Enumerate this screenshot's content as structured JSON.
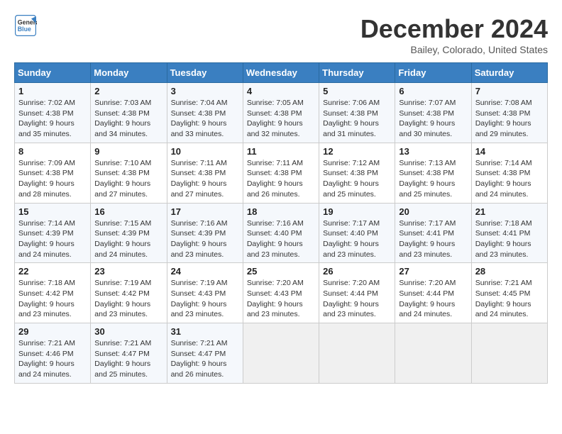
{
  "logo": {
    "line1": "General",
    "line2": "Blue"
  },
  "title": "December 2024",
  "location": "Bailey, Colorado, United States",
  "days_header": [
    "Sunday",
    "Monday",
    "Tuesday",
    "Wednesday",
    "Thursday",
    "Friday",
    "Saturday"
  ],
  "weeks": [
    [
      {
        "day": "1",
        "sunrise": "7:02 AM",
        "sunset": "4:38 PM",
        "daylight": "9 hours and 35 minutes."
      },
      {
        "day": "2",
        "sunrise": "7:03 AM",
        "sunset": "4:38 PM",
        "daylight": "9 hours and 34 minutes."
      },
      {
        "day": "3",
        "sunrise": "7:04 AM",
        "sunset": "4:38 PM",
        "daylight": "9 hours and 33 minutes."
      },
      {
        "day": "4",
        "sunrise": "7:05 AM",
        "sunset": "4:38 PM",
        "daylight": "9 hours and 32 minutes."
      },
      {
        "day": "5",
        "sunrise": "7:06 AM",
        "sunset": "4:38 PM",
        "daylight": "9 hours and 31 minutes."
      },
      {
        "day": "6",
        "sunrise": "7:07 AM",
        "sunset": "4:38 PM",
        "daylight": "9 hours and 30 minutes."
      },
      {
        "day": "7",
        "sunrise": "7:08 AM",
        "sunset": "4:38 PM",
        "daylight": "9 hours and 29 minutes."
      }
    ],
    [
      {
        "day": "8",
        "sunrise": "7:09 AM",
        "sunset": "4:38 PM",
        "daylight": "9 hours and 28 minutes."
      },
      {
        "day": "9",
        "sunrise": "7:10 AM",
        "sunset": "4:38 PM",
        "daylight": "9 hours and 27 minutes."
      },
      {
        "day": "10",
        "sunrise": "7:11 AM",
        "sunset": "4:38 PM",
        "daylight": "9 hours and 27 minutes."
      },
      {
        "day": "11",
        "sunrise": "7:11 AM",
        "sunset": "4:38 PM",
        "daylight": "9 hours and 26 minutes."
      },
      {
        "day": "12",
        "sunrise": "7:12 AM",
        "sunset": "4:38 PM",
        "daylight": "9 hours and 25 minutes."
      },
      {
        "day": "13",
        "sunrise": "7:13 AM",
        "sunset": "4:38 PM",
        "daylight": "9 hours and 25 minutes."
      },
      {
        "day": "14",
        "sunrise": "7:14 AM",
        "sunset": "4:38 PM",
        "daylight": "9 hours and 24 minutes."
      }
    ],
    [
      {
        "day": "15",
        "sunrise": "7:14 AM",
        "sunset": "4:39 PM",
        "daylight": "9 hours and 24 minutes."
      },
      {
        "day": "16",
        "sunrise": "7:15 AM",
        "sunset": "4:39 PM",
        "daylight": "9 hours and 24 minutes."
      },
      {
        "day": "17",
        "sunrise": "7:16 AM",
        "sunset": "4:39 PM",
        "daylight": "9 hours and 23 minutes."
      },
      {
        "day": "18",
        "sunrise": "7:16 AM",
        "sunset": "4:40 PM",
        "daylight": "9 hours and 23 minutes."
      },
      {
        "day": "19",
        "sunrise": "7:17 AM",
        "sunset": "4:40 PM",
        "daylight": "9 hours and 23 minutes."
      },
      {
        "day": "20",
        "sunrise": "7:17 AM",
        "sunset": "4:41 PM",
        "daylight": "9 hours and 23 minutes."
      },
      {
        "day": "21",
        "sunrise": "7:18 AM",
        "sunset": "4:41 PM",
        "daylight": "9 hours and 23 minutes."
      }
    ],
    [
      {
        "day": "22",
        "sunrise": "7:18 AM",
        "sunset": "4:42 PM",
        "daylight": "9 hours and 23 minutes."
      },
      {
        "day": "23",
        "sunrise": "7:19 AM",
        "sunset": "4:42 PM",
        "daylight": "9 hours and 23 minutes."
      },
      {
        "day": "24",
        "sunrise": "7:19 AM",
        "sunset": "4:43 PM",
        "daylight": "9 hours and 23 minutes."
      },
      {
        "day": "25",
        "sunrise": "7:20 AM",
        "sunset": "4:43 PM",
        "daylight": "9 hours and 23 minutes."
      },
      {
        "day": "26",
        "sunrise": "7:20 AM",
        "sunset": "4:44 PM",
        "daylight": "9 hours and 23 minutes."
      },
      {
        "day": "27",
        "sunrise": "7:20 AM",
        "sunset": "4:44 PM",
        "daylight": "9 hours and 24 minutes."
      },
      {
        "day": "28",
        "sunrise": "7:21 AM",
        "sunset": "4:45 PM",
        "daylight": "9 hours and 24 minutes."
      }
    ],
    [
      {
        "day": "29",
        "sunrise": "7:21 AM",
        "sunset": "4:46 PM",
        "daylight": "9 hours and 24 minutes."
      },
      {
        "day": "30",
        "sunrise": "7:21 AM",
        "sunset": "4:47 PM",
        "daylight": "9 hours and 25 minutes."
      },
      {
        "day": "31",
        "sunrise": "7:21 AM",
        "sunset": "4:47 PM",
        "daylight": "9 hours and 26 minutes."
      },
      null,
      null,
      null,
      null
    ]
  ]
}
